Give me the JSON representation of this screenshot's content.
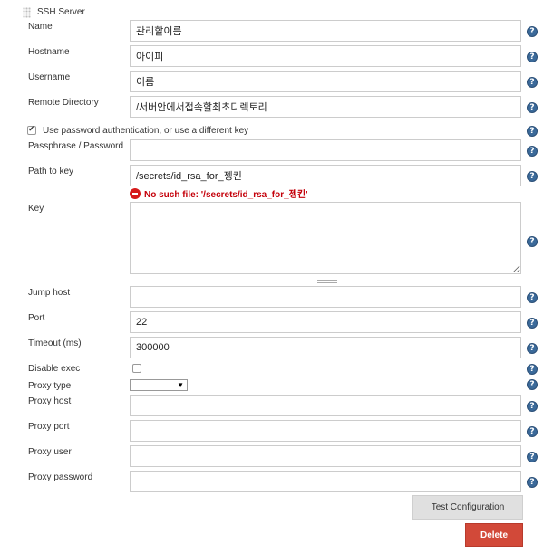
{
  "section": {
    "title": "SSH Server"
  },
  "fields": {
    "name": {
      "label": "Name",
      "value": "관리할이름"
    },
    "hostname": {
      "label": "Hostname",
      "value": "아이피"
    },
    "username": {
      "label": "Username",
      "value": "이름"
    },
    "remote_directory": {
      "label": "Remote Directory",
      "value": "/서버안에서접속할최초디렉토리"
    },
    "use_password": {
      "label": "Use password authentication, or use a different key",
      "checked": true
    },
    "passphrase": {
      "label": "Passphrase / Password",
      "value": ""
    },
    "path_to_key": {
      "label": "Path to key",
      "value": "/secrets/id_rsa_for_젱킨",
      "error": "No such file: '/secrets/id_rsa_for_젱킨'"
    },
    "key": {
      "label": "Key",
      "value": ""
    },
    "jump_host": {
      "label": "Jump host",
      "value": ""
    },
    "port": {
      "label": "Port",
      "value": "22"
    },
    "timeout": {
      "label": "Timeout (ms)",
      "value": "300000"
    },
    "disable_exec": {
      "label": "Disable exec",
      "checked": false
    },
    "proxy_type": {
      "label": "Proxy type",
      "value": ""
    },
    "proxy_host": {
      "label": "Proxy host",
      "value": ""
    },
    "proxy_port": {
      "label": "Proxy port",
      "value": ""
    },
    "proxy_user": {
      "label": "Proxy user",
      "value": ""
    },
    "proxy_password": {
      "label": "Proxy password",
      "value": ""
    }
  },
  "buttons": {
    "test": "Test Configuration",
    "delete": "Delete"
  },
  "icons": {
    "help": "?"
  },
  "colors": {
    "delete_bg": "#d24939",
    "error": "#c4000a",
    "help": "#3b6a9a"
  }
}
